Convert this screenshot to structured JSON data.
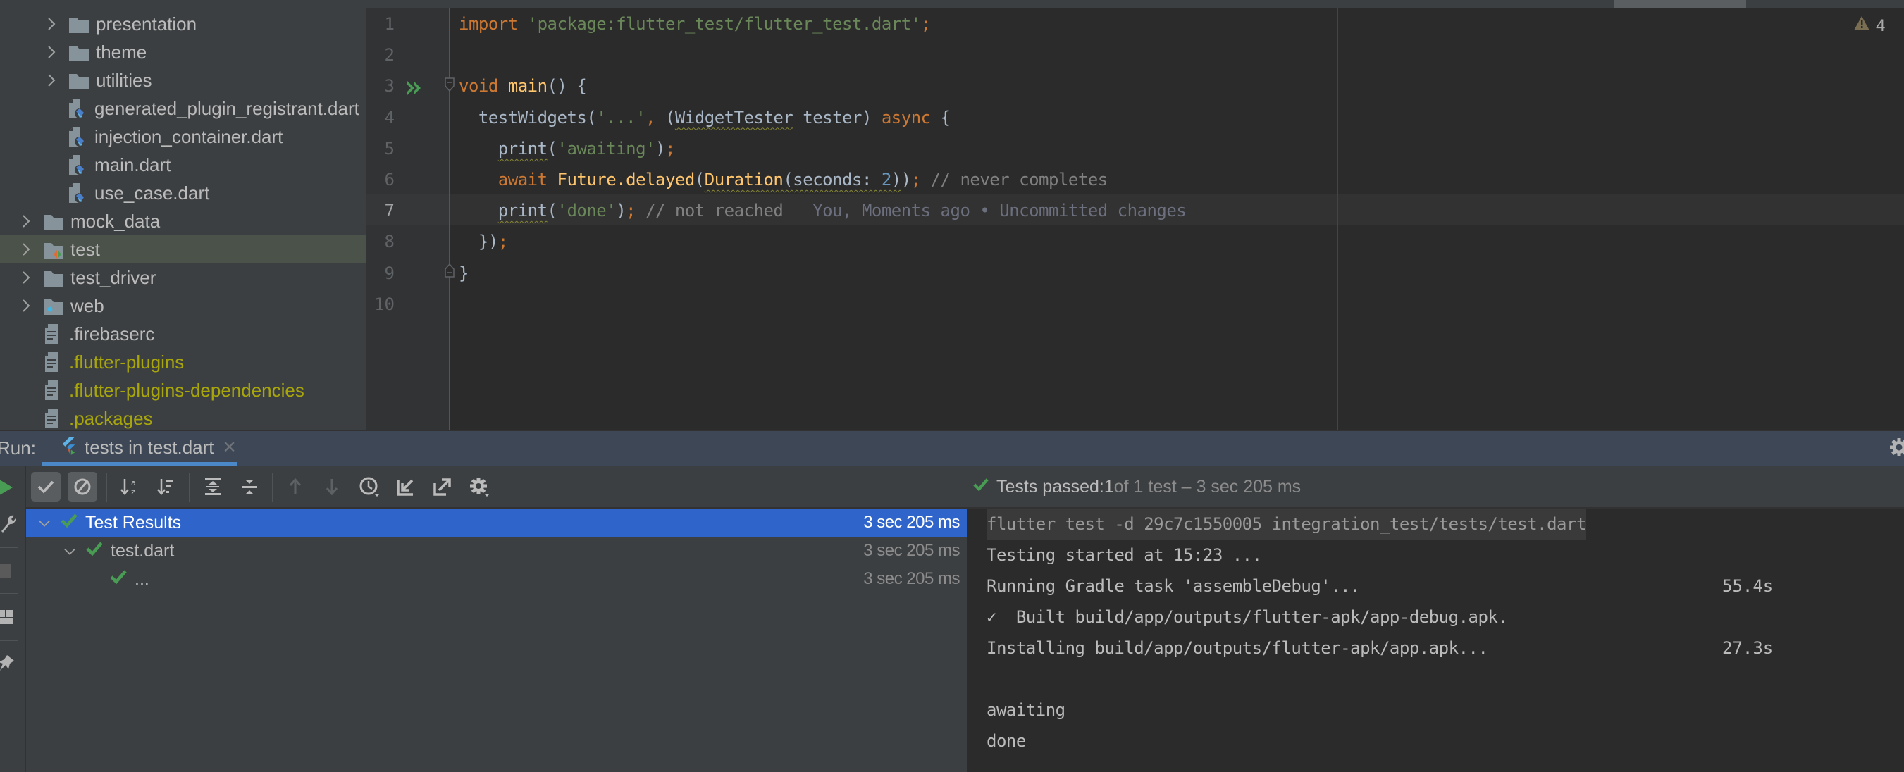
{
  "project_tree": {
    "items": [
      {
        "label": "presentation",
        "type": "folder",
        "expandable": true,
        "indent": 2
      },
      {
        "label": "theme",
        "type": "folder",
        "expandable": true,
        "indent": 2
      },
      {
        "label": "utilities",
        "type": "folder",
        "expandable": true,
        "indent": 2
      },
      {
        "label": "generated_plugin_registrant.dart",
        "type": "dart-file",
        "expandable": false,
        "indent": 2
      },
      {
        "label": "injection_container.dart",
        "type": "dart-file",
        "expandable": false,
        "indent": 2
      },
      {
        "label": "main.dart",
        "type": "dart-file",
        "expandable": false,
        "indent": 2
      },
      {
        "label": "use_case.dart",
        "type": "dart-file",
        "expandable": false,
        "indent": 2
      },
      {
        "label": "mock_data",
        "type": "folder",
        "expandable": true,
        "indent": 1
      },
      {
        "label": "test",
        "type": "test-folder",
        "expandable": true,
        "indent": 1,
        "selected": true
      },
      {
        "label": "test_driver",
        "type": "folder",
        "expandable": true,
        "indent": 1
      },
      {
        "label": "web",
        "type": "web-folder",
        "expandable": true,
        "indent": 1
      },
      {
        "label": ".firebaserc",
        "type": "text-file",
        "expandable": false,
        "indent": 1
      },
      {
        "label": ".flutter-plugins",
        "type": "text-file",
        "expandable": false,
        "indent": 1,
        "ignored": true
      },
      {
        "label": ".flutter-plugins-dependencies",
        "type": "text-file",
        "expandable": false,
        "indent": 1,
        "ignored": true
      },
      {
        "label": ".packages",
        "type": "text-file",
        "expandable": false,
        "indent": 1,
        "ignored": true
      }
    ]
  },
  "editor": {
    "inspection_warnings": "4",
    "current_line": 7,
    "line_numbers": [
      "1",
      "2",
      "3",
      "4",
      "5",
      "6",
      "7",
      "8",
      "9",
      "10"
    ],
    "lines": [
      [
        {
          "t": "import ",
          "c": "kw"
        },
        {
          "t": "'package:flutter_test/flutter_test.dart'",
          "c": "str"
        },
        {
          "t": ";",
          "c": "kw"
        }
      ],
      [],
      [
        {
          "t": "void ",
          "c": "kw"
        },
        {
          "t": "main",
          "c": "fn"
        },
        {
          "t": "() {",
          "c": ""
        }
      ],
      [
        {
          "t": "  testWidgets(",
          "c": ""
        },
        {
          "t": "'...'",
          "c": "str"
        },
        {
          "t": ", ",
          "c": "kw"
        },
        {
          "t": "(",
          "c": ""
        },
        {
          "t": "WidgetTester",
          "c": "warn"
        },
        {
          "t": " tester) ",
          "c": ""
        },
        {
          "t": "async",
          "c": "kw"
        },
        {
          "t": " {",
          "c": ""
        }
      ],
      [
        {
          "t": "    ",
          "c": ""
        },
        {
          "t": "print",
          "c": "warn"
        },
        {
          "t": "(",
          "c": ""
        },
        {
          "t": "'awaiting'",
          "c": "str"
        },
        {
          "t": ")",
          "c": ""
        },
        {
          "t": ";",
          "c": "kw"
        }
      ],
      [
        {
          "t": "    ",
          "c": ""
        },
        {
          "t": "await ",
          "c": "kw"
        },
        {
          "t": "Future.delayed",
          "c": "fn"
        },
        {
          "t": "(",
          "c": ""
        },
        {
          "t": "Duration",
          "c": "fn warn"
        },
        {
          "t": "(",
          "c": "warn"
        },
        {
          "t": "seconds: ",
          "c": "warn"
        },
        {
          "t": "2",
          "c": "num warn"
        },
        {
          "t": ")",
          "c": "warn"
        },
        {
          "t": ")",
          "c": ""
        },
        {
          "t": "; ",
          "c": "kw"
        },
        {
          "t": "// never completes",
          "c": "cm"
        }
      ],
      [
        {
          "t": "    ",
          "c": ""
        },
        {
          "t": "print",
          "c": "warn"
        },
        {
          "t": "(",
          "c": ""
        },
        {
          "t": "'done'",
          "c": "str"
        },
        {
          "t": ")",
          "c": ""
        },
        {
          "t": "; ",
          "c": "kw"
        },
        {
          "t": "// not reached",
          "c": "cm"
        },
        {
          "t": "   You, Moments ago • Uncommitted changes",
          "c": "blame"
        }
      ],
      [
        {
          "t": "  })",
          "c": ""
        },
        {
          "t": ";",
          "c": "kw"
        }
      ],
      [
        {
          "t": "}",
          "c": ""
        }
      ],
      []
    ]
  },
  "run_panel": {
    "label": "Run:",
    "tab_label": "tests in test.dart",
    "toolbar": [
      {
        "name": "show-passed-toggle",
        "icon": "check-icon",
        "toggled": true
      },
      {
        "name": "show-ignored-toggle",
        "icon": "ignored-icon",
        "toggled": true
      },
      {
        "name": "sort-alphabetically-button",
        "icon": "sort-alpha-icon"
      },
      {
        "name": "sort-by-duration-button",
        "icon": "sort-duration-icon"
      },
      {
        "name": "expand-all-button",
        "icon": "expand-all-icon"
      },
      {
        "name": "collapse-all-button",
        "icon": "collapse-all-icon"
      },
      {
        "name": "previous-failed-button",
        "icon": "arrow-up-icon",
        "disabled": true
      },
      {
        "name": "next-failed-button",
        "icon": "arrow-down-icon",
        "disabled": true
      },
      {
        "name": "test-history-button",
        "icon": "clock-icon"
      },
      {
        "name": "import-tests-button",
        "icon": "import-icon"
      },
      {
        "name": "export-tests-button",
        "icon": "export-icon"
      },
      {
        "name": "test-settings-button",
        "icon": "gear-icon"
      }
    ],
    "status": {
      "prefix": "Tests passed: ",
      "passed": "1",
      "rest": " of 1 test – 3 sec 205 ms"
    },
    "test_tree": [
      {
        "label": "Test Results",
        "duration": "3 sec 205 ms",
        "selected": true,
        "expanded": true,
        "level": 0
      },
      {
        "label": "test.dart",
        "duration": "3 sec 205 ms",
        "expanded": true,
        "level": 1
      },
      {
        "label": "...",
        "duration": "3 sec 205 ms",
        "level": 2
      }
    ],
    "console": [
      {
        "text": "flutter test -d 29c7c1550005 integration_test/tests/test.dart",
        "time": "",
        "cmd": true
      },
      {
        "text": "Testing started at 15:23 ...",
        "time": ""
      },
      {
        "text": "Running Gradle task 'assembleDebug'...",
        "time": "55.4s"
      },
      {
        "text": "✓  Built build/app/outputs/flutter-apk/app-debug.apk.",
        "time": ""
      },
      {
        "text": "Installing build/app/outputs/flutter-apk/app.apk...",
        "time": "27.3s"
      },
      {
        "text": "",
        "time": ""
      },
      {
        "text": "awaiting",
        "time": ""
      },
      {
        "text": "done",
        "time": ""
      }
    ]
  },
  "colors": {
    "accent_blue": "#2f65ca",
    "pass_green": "#499c54",
    "keyword": "#cc7832",
    "string": "#6a8759",
    "function": "#ffc66d",
    "ignored_file": "#a8a60b"
  }
}
